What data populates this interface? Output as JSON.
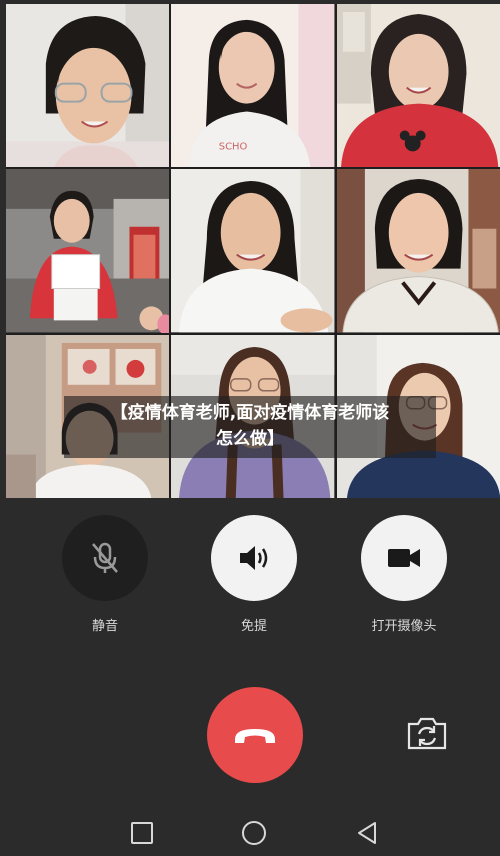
{
  "title_banner": {
    "line1": "【疫情体育老师,面对疫情体育老师该",
    "line2": "怎么做】"
  },
  "controls": [
    {
      "label": "静音",
      "icon": "mic-off-icon",
      "state": "off"
    },
    {
      "label": "免提",
      "icon": "speaker-icon",
      "state": "on"
    },
    {
      "label": "打开摄像头",
      "icon": "video-camera-icon",
      "state": "on"
    }
  ],
  "end_call": {
    "icon": "phone-hangup-icon",
    "color": "#e84b4b"
  },
  "switch_camera": {
    "icon": "switch-camera-icon"
  },
  "nav": {
    "icons": [
      "square-icon",
      "circle-icon",
      "back-triangle-icon"
    ]
  },
  "colors": {
    "background": "#2b2b2b",
    "button_dark": "#1f1f1f",
    "button_light": "#f2f2f2"
  }
}
